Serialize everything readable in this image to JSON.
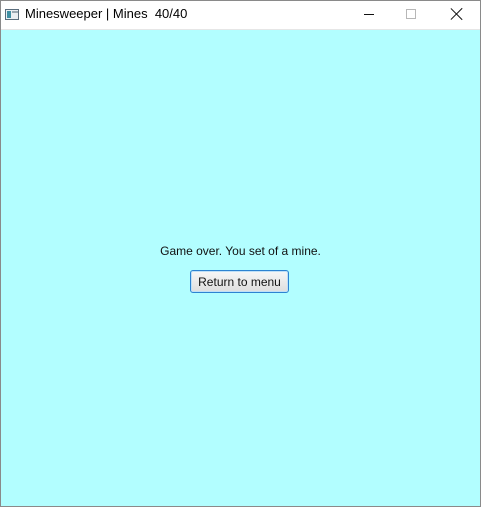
{
  "window": {
    "title": "Minesweeper | Mines  40/40",
    "icon": "app-window-icon",
    "controls": {
      "minimize": "minimize-icon",
      "maximize": "maximize-icon",
      "close": "close-icon"
    }
  },
  "game": {
    "message": "Game over. You set of a mine.",
    "return_button_label": "Return to menu"
  },
  "colors": {
    "background": "#b2feff",
    "button_border": "#2d83d1"
  }
}
